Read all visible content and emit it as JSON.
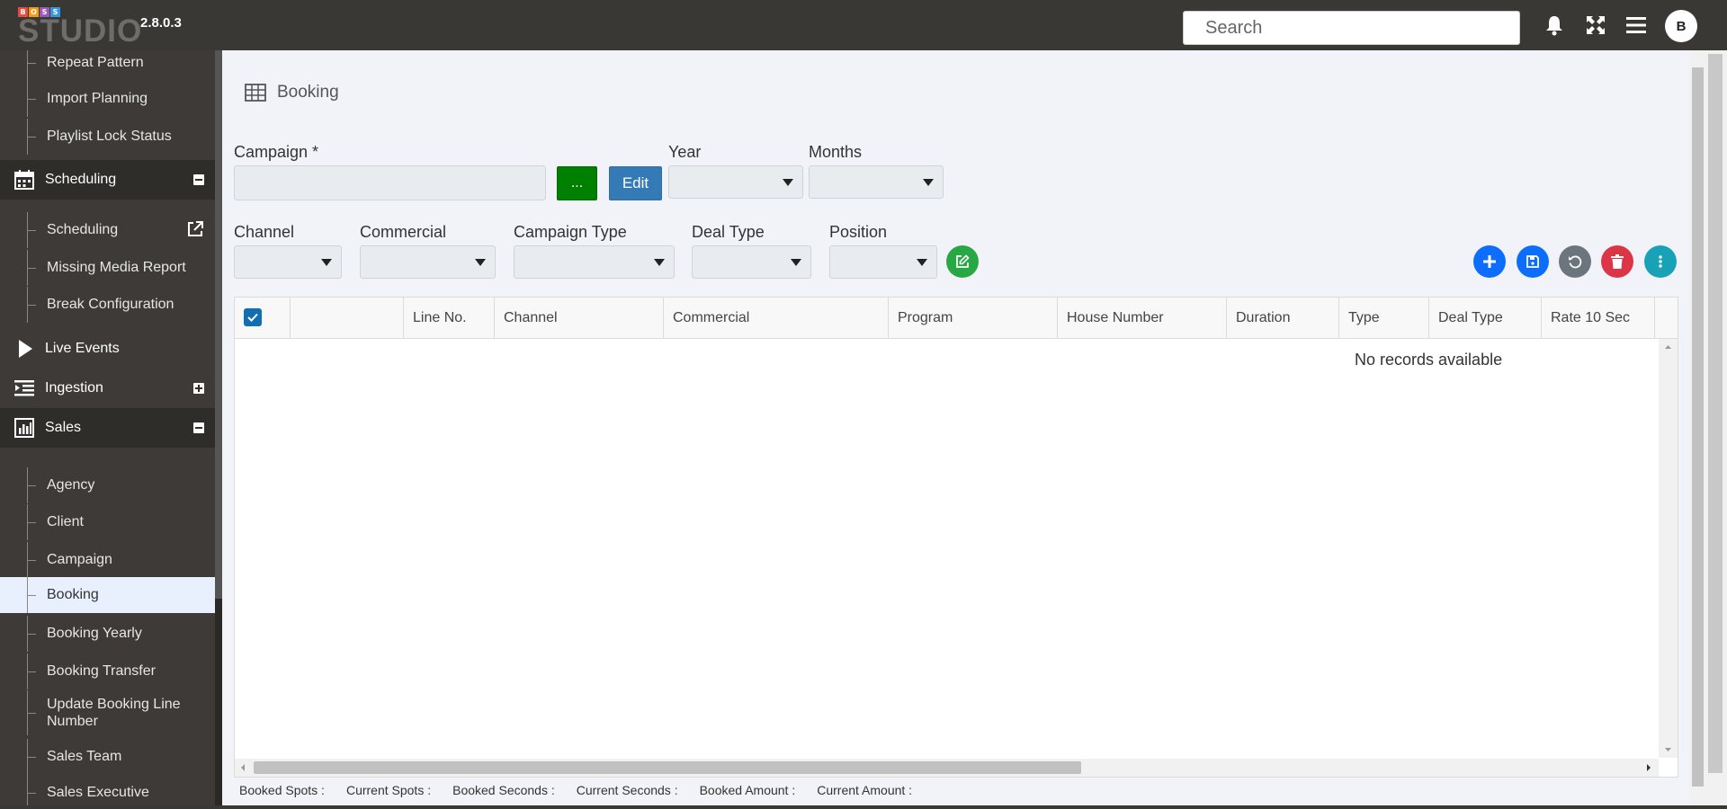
{
  "app": {
    "logo_letters": [
      "B",
      "O",
      "S",
      "S"
    ],
    "logo_colors": [
      "#e74c3c",
      "#f39c12",
      "#9b59b6",
      "#3498db"
    ],
    "logo_text": "STUDIO",
    "version": "2.8.0.3",
    "search_placeholder": "Search",
    "avatar_initial": "B"
  },
  "sidebar": {
    "top_items": [
      "Repeat Pattern",
      "Import Planning",
      "Playlist Lock Status"
    ],
    "scheduling": {
      "label": "Scheduling",
      "items": [
        "Scheduling",
        "Missing Media Report",
        "Break Configuration"
      ]
    },
    "live_events": "Live Events",
    "ingestion": "Ingestion",
    "sales": {
      "label": "Sales",
      "items": [
        "Agency",
        "Client",
        "Campaign",
        "Booking",
        "Booking Yearly",
        "Booking Transfer",
        "Update Booking Line Number",
        "Sales Team",
        "Sales Executive"
      ]
    }
  },
  "page": {
    "title": "Booking",
    "form": {
      "campaign_label": "Campaign *",
      "dots_label": "...",
      "edit_label": "Edit",
      "year_label": "Year",
      "months_label": "Months",
      "channel_label": "Channel",
      "commercial_label": "Commercial",
      "campaign_type_label": "Campaign Type",
      "deal_type_label": "Deal Type",
      "position_label": "Position"
    },
    "grid": {
      "columns": [
        "Line No.",
        "Channel",
        "Commercial",
        "Program",
        "House Number",
        "Duration",
        "Type",
        "Deal Type",
        "Rate 10 Sec"
      ],
      "empty_text": "No records available"
    },
    "footer": [
      "Booked Spots :",
      "Current Spots :",
      "Booked Seconds :",
      "Current Seconds :",
      "Booked Amount :",
      "Current Amount :"
    ]
  },
  "colors": {
    "topbar": "#3a3835",
    "sidebar": "#3d3a37",
    "add": "#0d6efd",
    "save": "#0d6efd",
    "reset": "#6c757d",
    "delete": "#dc3545",
    "more": "#17a2b8",
    "edit_green": "#28a745"
  }
}
